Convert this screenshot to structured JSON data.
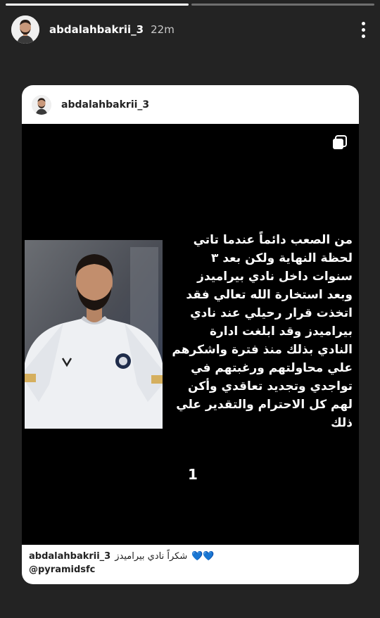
{
  "story": {
    "progress": [
      1.0,
      0.0
    ]
  },
  "header": {
    "username": "abdalahbakrii_3",
    "time": "22m",
    "avatar_icon": "profile-avatar",
    "more_icon": "more-vertical-icon"
  },
  "card": {
    "username": "abdalahbakrii_3",
    "multi_icon": "carousel-icon",
    "post_text": "من الصعب دائماً عندما تاتي\nلحظة النهاية ولكن بعد ٣\nسنوات  داخل نادي بيراميدز\nوبعد استخارة الله تعالي فقد\nاتخذت قرار رحيلي عند نادي\nبيراميدز   وقد ابلغت ادارة\nالنادي بذلك منذ فترة واشكرهم\nعلي محاولتهم ورغبتهم في\nتواجدي  وتجديد تعاقدي وأكن\nلهم كل الاحترام والتقدير علي\nذلك",
    "post_number": "1",
    "caption_user": "abdalahbakrii_3",
    "caption_text": "شكراً نادي بيراميدز",
    "caption_emoji": "💙💙",
    "mention": "@pyramidsfc"
  },
  "colors": {
    "background": "#232323",
    "heart": "#1e88e5"
  }
}
